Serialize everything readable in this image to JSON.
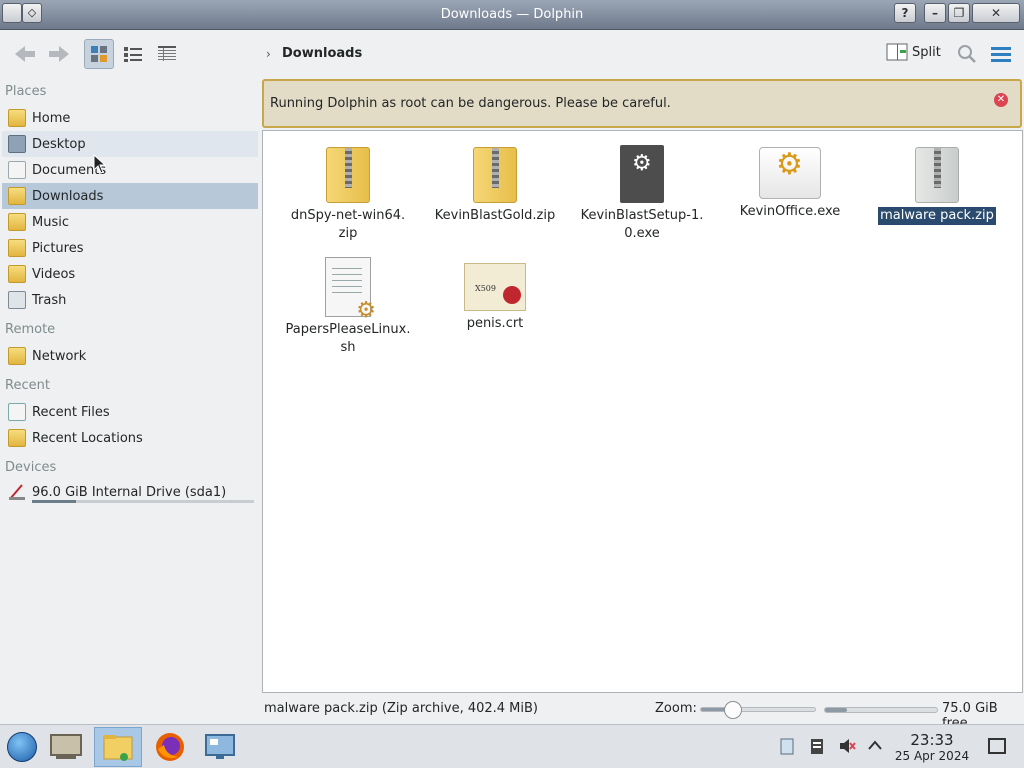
{
  "window": {
    "title": "Downloads — Dolphin"
  },
  "toolbar": {
    "breadcrumb": "Downloads",
    "split_label": "Split"
  },
  "sidebar": {
    "places_heading": "Places",
    "remote_heading": "Remote",
    "recent_heading": "Recent",
    "devices_heading": "Devices",
    "items": [
      {
        "label": "Home",
        "icon": "home-folder-icon"
      },
      {
        "label": "Desktop",
        "icon": "desktop-icon"
      },
      {
        "label": "Documents",
        "icon": "documents-folder-icon"
      },
      {
        "label": "Downloads",
        "icon": "downloads-folder-icon"
      },
      {
        "label": "Music",
        "icon": "music-folder-icon"
      },
      {
        "label": "Pictures",
        "icon": "pictures-folder-icon"
      },
      {
        "label": "Videos",
        "icon": "videos-folder-icon"
      },
      {
        "label": "Trash",
        "icon": "trash-icon"
      },
      {
        "label": "Network",
        "icon": "network-folder-icon"
      },
      {
        "label": "Recent Files",
        "icon": "recent-files-icon"
      },
      {
        "label": "Recent Locations",
        "icon": "recent-locations-icon"
      },
      {
        "label": "96.0 GiB Internal Drive (sda1)",
        "icon": "hard-drive-icon"
      }
    ],
    "drive_usage_fraction": 0.2
  },
  "warning": {
    "message": "Running Dolphin as root can be dangerous. Please be careful."
  },
  "files": [
    {
      "name": "dnSpy-net-win64.\nzip",
      "type": "zip"
    },
    {
      "name": "KevinBlastGold.zip",
      "type": "zip"
    },
    {
      "name": "KevinBlastSetup-1.\n0.exe",
      "type": "exe"
    },
    {
      "name": "KevinOffice.exe",
      "type": "app"
    },
    {
      "name": "malware pack.zip",
      "type": "zip",
      "selected": true
    },
    {
      "name": "PapersPleaseLinux.\nsh",
      "type": "script"
    },
    {
      "name": "penis.crt",
      "type": "certificate"
    }
  ],
  "statusbar": {
    "selection_info": "malware pack.zip (Zip archive, 402.4 MiB)",
    "zoom_label": "Zoom:",
    "zoom_fraction": 0.28,
    "free_space": "75.0 GiB free",
    "used_fraction": 0.2
  },
  "taskbar": {
    "time": "23:33",
    "date": "25 Apr 2024"
  },
  "colors": {
    "selection": "#2a4b6e",
    "warning_border": "#c9a64a",
    "warning_bg": "#e2dcc7",
    "sidebar_selected": "#b7c9d9"
  }
}
